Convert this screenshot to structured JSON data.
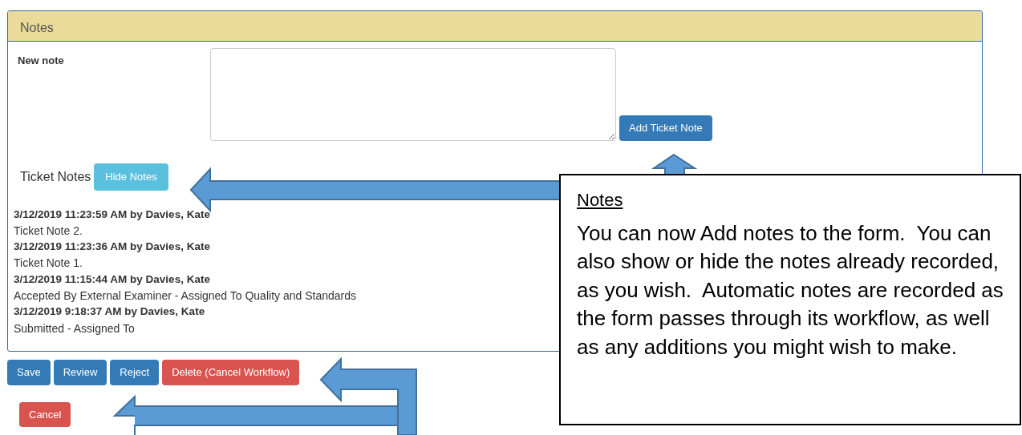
{
  "panel": {
    "title": "Notes",
    "new_note_label": "New note",
    "add_button": "Add Ticket Note",
    "ticket_notes_label": "Ticket Notes",
    "toggle_button": "Hide Notes",
    "notes": [
      {
        "header": "3/12/2019 11:23:59 AM by Davies, Kate",
        "text": "Ticket Note 2."
      },
      {
        "header": "3/12/2019 11:23:36 AM by Davies, Kate",
        "text": "Ticket Note 1."
      },
      {
        "header": "3/12/2019 11:15:44 AM by Davies, Kate",
        "text": "Accepted By External Examiner - Assigned To Quality and Standards"
      },
      {
        "header": "3/12/2019 9:18:37 AM by Davies, Kate",
        "text": "Submitted - Assigned To"
      }
    ]
  },
  "actions": [
    {
      "label": "Save",
      "kind": "primary"
    },
    {
      "label": "Review",
      "kind": "primary"
    },
    {
      "label": "Reject",
      "kind": "primary"
    },
    {
      "label": "Delete (Cancel Workflow)",
      "kind": "danger"
    }
  ],
  "cancel": {
    "label": "Cancel",
    "kind": "danger"
  },
  "callout": {
    "title": "Notes",
    "text": "You can now Add notes to the form.  You can also show or hide the notes already recorded, as you wish.  Automatic notes are recorded as the form passes through its workflow, as well as any additions you might wish to make."
  }
}
